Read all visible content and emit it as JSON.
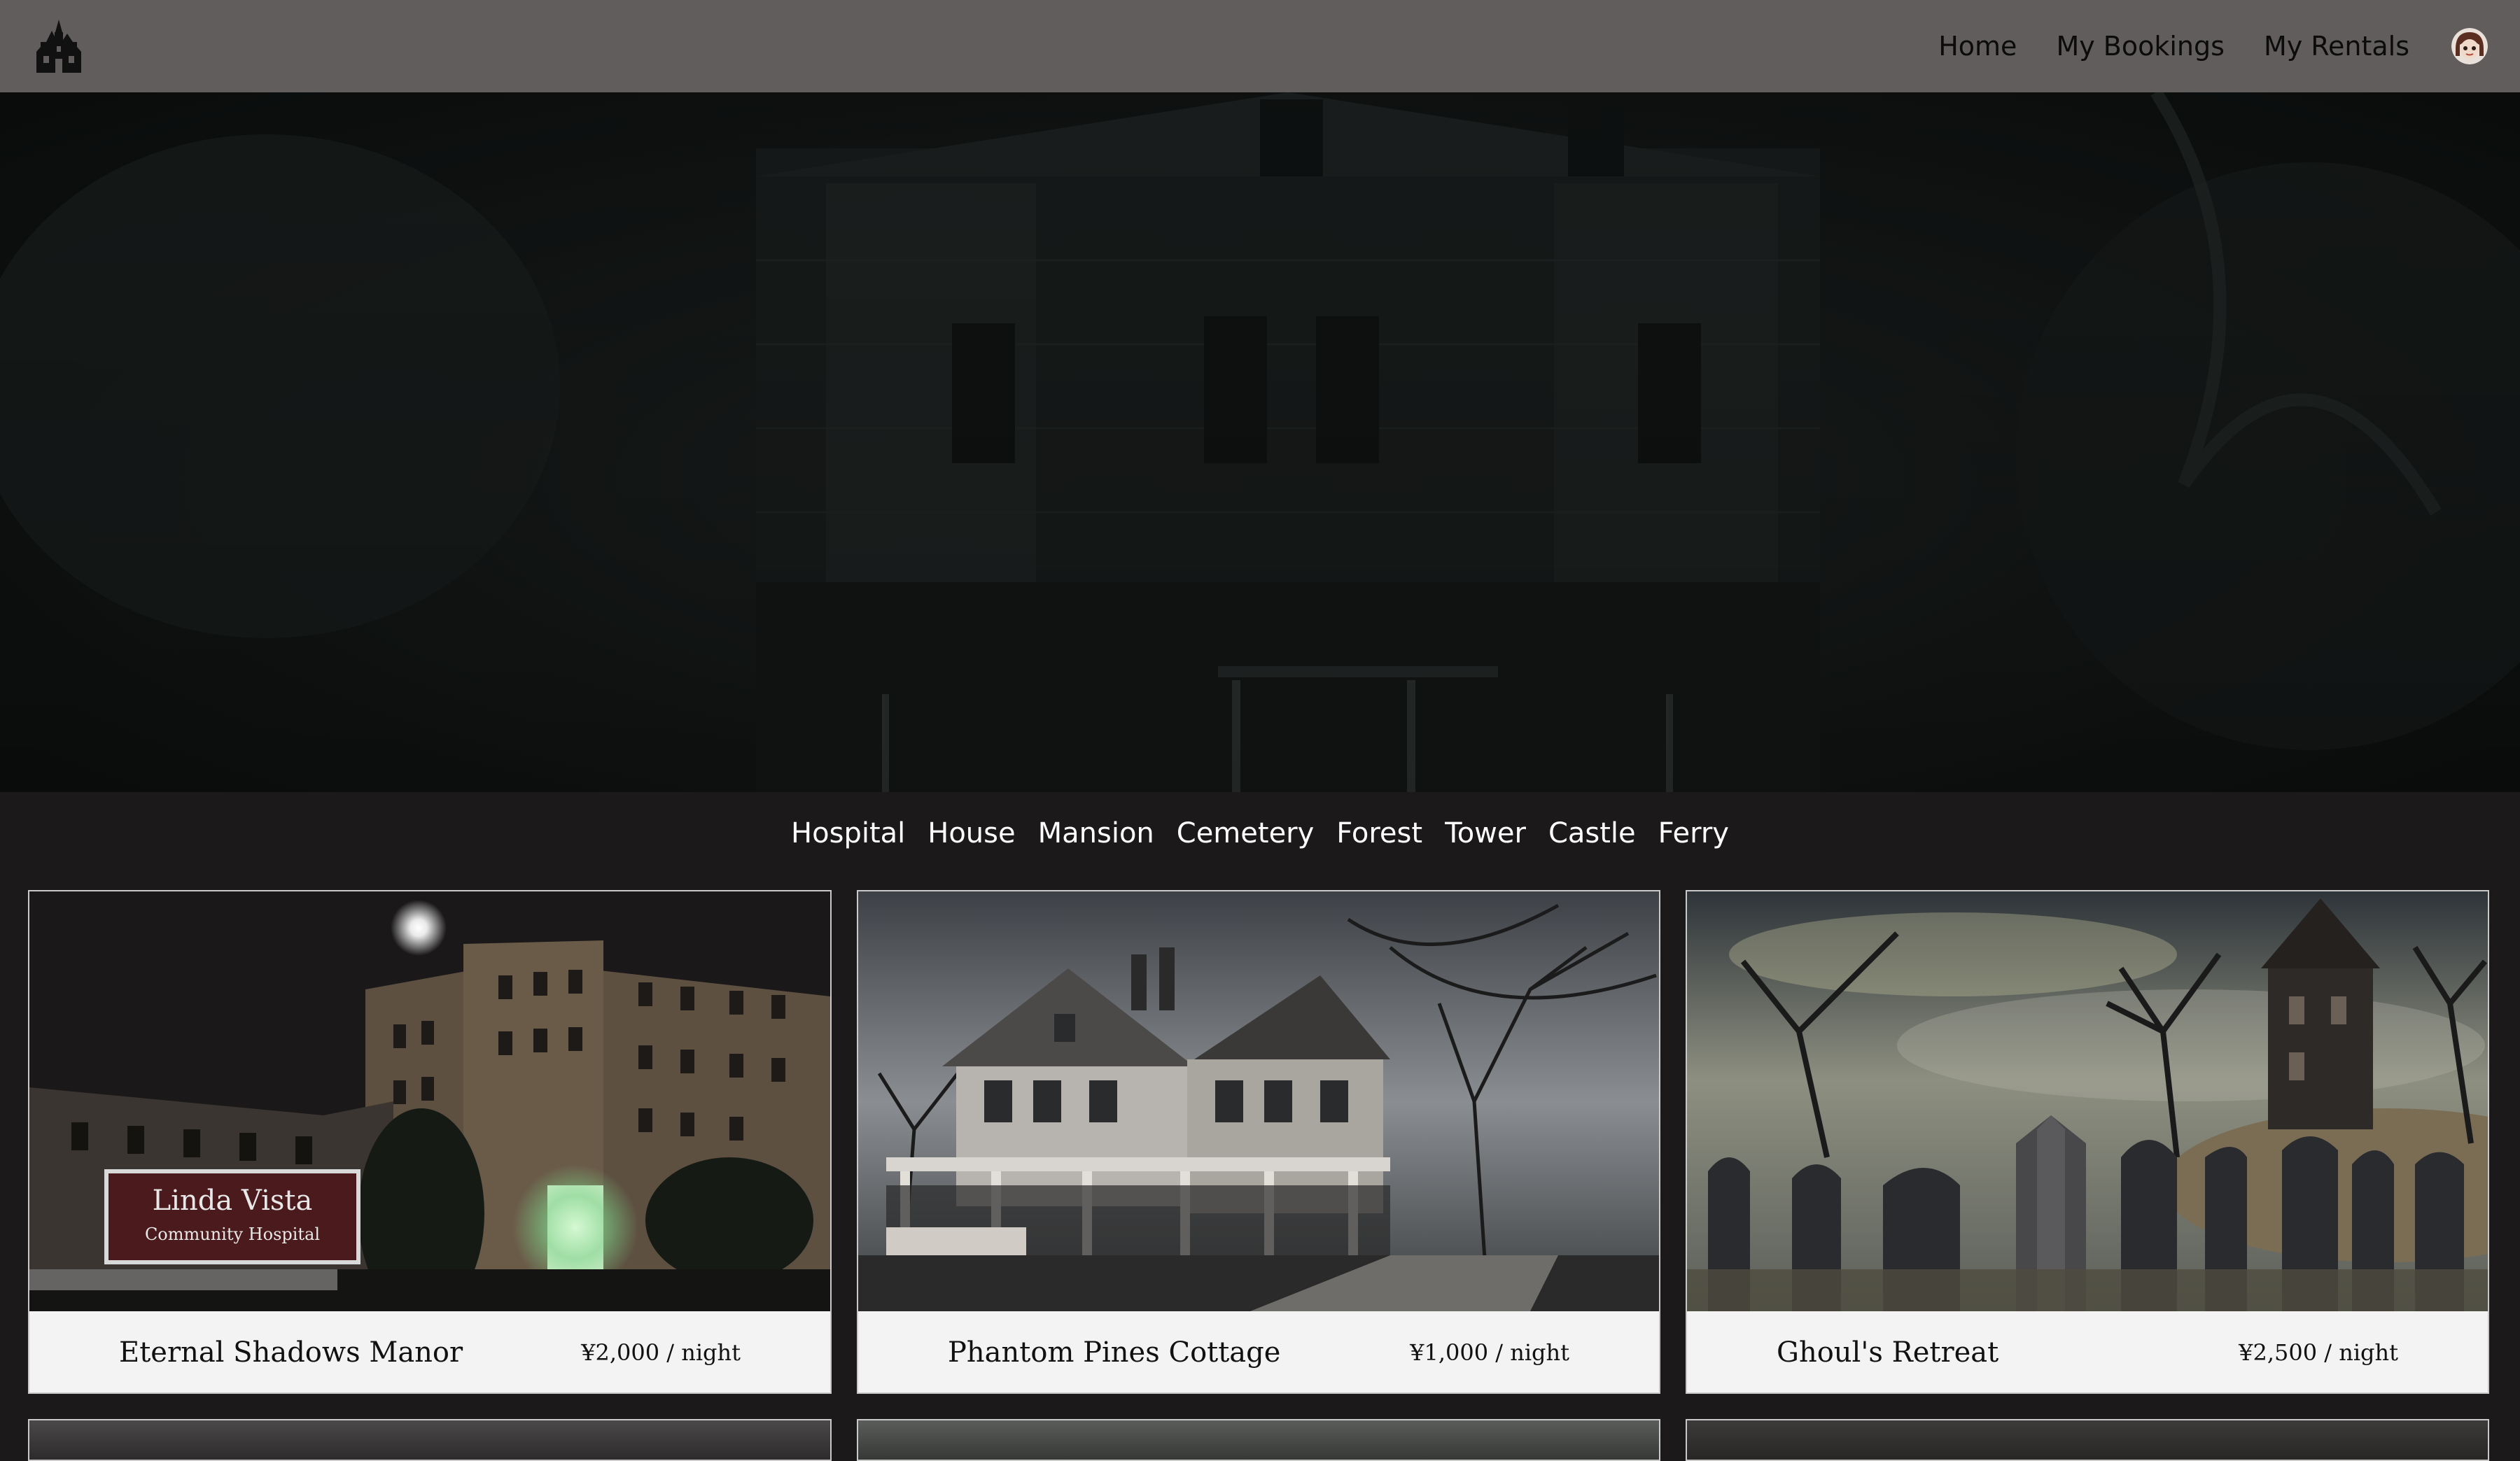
{
  "nav": {
    "logo_icon": "haunted-house-icon",
    "links": [
      "Home",
      "My Bookings",
      "My Rentals"
    ],
    "avatar_icon": "user-avatar-icon"
  },
  "categories": [
    "Hospital",
    "House",
    "Mansion",
    "Cemetery",
    "Forest",
    "Tower",
    "Castle",
    "Ferry"
  ],
  "listings": [
    {
      "title": "Eternal Shadows Manor",
      "price": "¥2,000 / night"
    },
    {
      "title": "Phantom Pines Cottage",
      "price": "¥1,000 / night"
    },
    {
      "title": "Ghoul's Retreat",
      "price": "¥2,500 / night"
    }
  ],
  "colors": {
    "navbar": "#625d5d",
    "page_background": "#1b191a",
    "card_caption": "#f3f3f3"
  }
}
